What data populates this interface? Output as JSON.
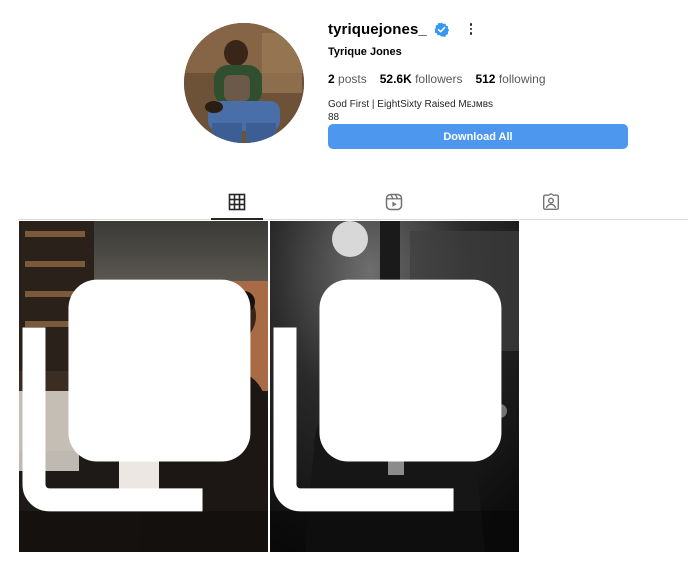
{
  "profile": {
    "username": "tyriquejones_",
    "full_name": "Tyrique Jones",
    "stats": {
      "posts_count": "2",
      "posts_label": "posts",
      "followers_count": "52.6K",
      "followers_label": "followers",
      "following_count": "512",
      "following_label": "following"
    },
    "bio_line1": "God First | EightSixty Raised Mᴇᴊᴍʙs",
    "bio_line2": "88",
    "download_label": "Download All"
  },
  "tabs": [
    {
      "icon": "grid-icon",
      "active": true
    },
    {
      "icon": "reels-icon",
      "active": false
    },
    {
      "icon": "tagged-icon",
      "active": false
    }
  ],
  "posts": [
    {
      "kind": "color-photo",
      "multi": true
    },
    {
      "kind": "bw-photo",
      "multi": true
    }
  ],
  "colors": {
    "button_blue": "#4d97ee",
    "verified_blue": "#3897f0",
    "divider": "#dbdbdb"
  }
}
